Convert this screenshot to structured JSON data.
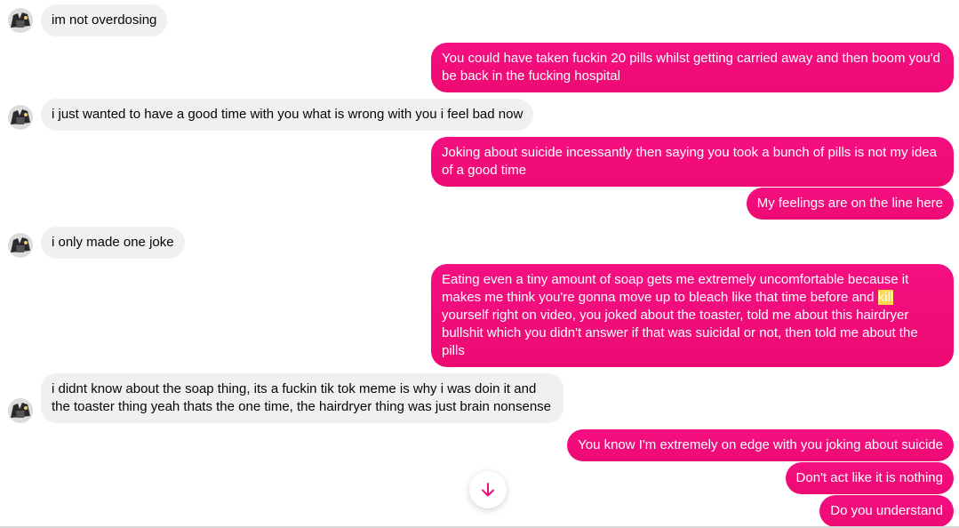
{
  "conversation": {
    "messages": [
      {
        "side": "in",
        "text": "im not overdosing"
      },
      {
        "side": "out",
        "text": "You could have taken fuckin 20 pills whilst getting carried away and then boom you'd be back in the fucking hospital"
      },
      {
        "side": "in",
        "text": "i just wanted to have a good time with you what is wrong with you i feel bad now"
      },
      {
        "side": "out",
        "text": "Joking about suicide incessantly then saying you took a bunch of pills is not my idea of a good time"
      },
      {
        "side": "out",
        "text": "My feelings are on the line here"
      },
      {
        "side": "in",
        "text": "i only made one joke"
      },
      {
        "side": "out",
        "text_before": "Eating even a tiny amount of soap gets me extremely uncomfortable because it makes me think you're gonna move up to bleach like that time before and ",
        "text_highlight": "kill",
        "text_after": " yourself right on video, you joked about the toaster, told me about this hairdryer bullshit which you didn't answer if that was suicidal or not, then told me about the pills"
      },
      {
        "side": "in",
        "text": "i didnt know about the soap thing, its a fuckin tik tok meme is why i was doin it and the toaster thing yeah thats the one time, the hairdryer thing was just brain nonsense"
      },
      {
        "side": "out",
        "text": "You know I'm extremely on edge with you joking about suicide"
      },
      {
        "side": "out",
        "text": "Don't act like it is nothing"
      },
      {
        "side": "out",
        "text": "Do you understand"
      }
    ]
  },
  "colors": {
    "outgoing_bubble": "#f30d80",
    "incoming_bubble": "#f0f0f0",
    "highlight": "#ffd84d",
    "scroll_arrow": "#f30d80"
  },
  "icons": {
    "scroll_down": "arrow-down-icon",
    "avatar": "contact-avatar"
  }
}
